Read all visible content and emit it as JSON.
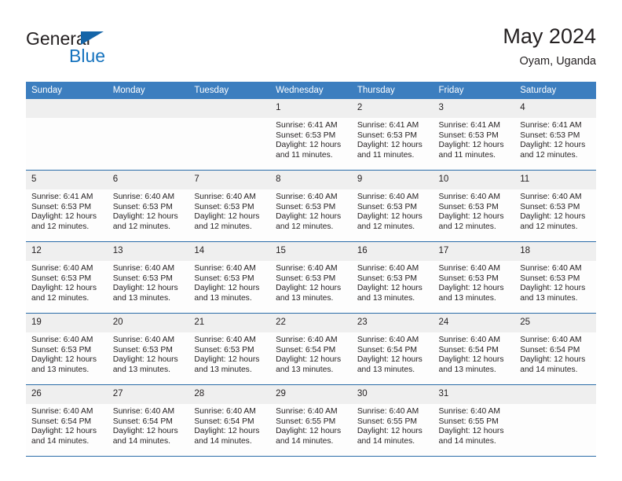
{
  "brand": {
    "name_dark": "General",
    "name_blue": "Blue",
    "logo_icon": "triangle-icon",
    "accent_color": "#1673be"
  },
  "header": {
    "title": "May 2024",
    "subtitle": "Oyam, Uganda"
  },
  "calendar": {
    "header_color": "#3c7ebf",
    "separator_color": "#2a6ca8",
    "daynum_band_color": "#efefef",
    "weekday_headers": [
      "Sunday",
      "Monday",
      "Tuesday",
      "Wednesday",
      "Thursday",
      "Friday",
      "Saturday"
    ],
    "weeks": [
      [
        {
          "day": "",
          "lines": []
        },
        {
          "day": "",
          "lines": []
        },
        {
          "day": "",
          "lines": []
        },
        {
          "day": "1",
          "lines": [
            "Sunrise: 6:41 AM",
            "Sunset: 6:53 PM",
            "Daylight: 12 hours",
            "and 11 minutes."
          ]
        },
        {
          "day": "2",
          "lines": [
            "Sunrise: 6:41 AM",
            "Sunset: 6:53 PM",
            "Daylight: 12 hours",
            "and 11 minutes."
          ]
        },
        {
          "day": "3",
          "lines": [
            "Sunrise: 6:41 AM",
            "Sunset: 6:53 PM",
            "Daylight: 12 hours",
            "and 11 minutes."
          ]
        },
        {
          "day": "4",
          "lines": [
            "Sunrise: 6:41 AM",
            "Sunset: 6:53 PM",
            "Daylight: 12 hours",
            "and 12 minutes."
          ]
        }
      ],
      [
        {
          "day": "5",
          "lines": [
            "Sunrise: 6:41 AM",
            "Sunset: 6:53 PM",
            "Daylight: 12 hours",
            "and 12 minutes."
          ]
        },
        {
          "day": "6",
          "lines": [
            "Sunrise: 6:40 AM",
            "Sunset: 6:53 PM",
            "Daylight: 12 hours",
            "and 12 minutes."
          ]
        },
        {
          "day": "7",
          "lines": [
            "Sunrise: 6:40 AM",
            "Sunset: 6:53 PM",
            "Daylight: 12 hours",
            "and 12 minutes."
          ]
        },
        {
          "day": "8",
          "lines": [
            "Sunrise: 6:40 AM",
            "Sunset: 6:53 PM",
            "Daylight: 12 hours",
            "and 12 minutes."
          ]
        },
        {
          "day": "9",
          "lines": [
            "Sunrise: 6:40 AM",
            "Sunset: 6:53 PM",
            "Daylight: 12 hours",
            "and 12 minutes."
          ]
        },
        {
          "day": "10",
          "lines": [
            "Sunrise: 6:40 AM",
            "Sunset: 6:53 PM",
            "Daylight: 12 hours",
            "and 12 minutes."
          ]
        },
        {
          "day": "11",
          "lines": [
            "Sunrise: 6:40 AM",
            "Sunset: 6:53 PM",
            "Daylight: 12 hours",
            "and 12 minutes."
          ]
        }
      ],
      [
        {
          "day": "12",
          "lines": [
            "Sunrise: 6:40 AM",
            "Sunset: 6:53 PM",
            "Daylight: 12 hours",
            "and 12 minutes."
          ]
        },
        {
          "day": "13",
          "lines": [
            "Sunrise: 6:40 AM",
            "Sunset: 6:53 PM",
            "Daylight: 12 hours",
            "and 13 minutes."
          ]
        },
        {
          "day": "14",
          "lines": [
            "Sunrise: 6:40 AM",
            "Sunset: 6:53 PM",
            "Daylight: 12 hours",
            "and 13 minutes."
          ]
        },
        {
          "day": "15",
          "lines": [
            "Sunrise: 6:40 AM",
            "Sunset: 6:53 PM",
            "Daylight: 12 hours",
            "and 13 minutes."
          ]
        },
        {
          "day": "16",
          "lines": [
            "Sunrise: 6:40 AM",
            "Sunset: 6:53 PM",
            "Daylight: 12 hours",
            "and 13 minutes."
          ]
        },
        {
          "day": "17",
          "lines": [
            "Sunrise: 6:40 AM",
            "Sunset: 6:53 PM",
            "Daylight: 12 hours",
            "and 13 minutes."
          ]
        },
        {
          "day": "18",
          "lines": [
            "Sunrise: 6:40 AM",
            "Sunset: 6:53 PM",
            "Daylight: 12 hours",
            "and 13 minutes."
          ]
        }
      ],
      [
        {
          "day": "19",
          "lines": [
            "Sunrise: 6:40 AM",
            "Sunset: 6:53 PM",
            "Daylight: 12 hours",
            "and 13 minutes."
          ]
        },
        {
          "day": "20",
          "lines": [
            "Sunrise: 6:40 AM",
            "Sunset: 6:53 PM",
            "Daylight: 12 hours",
            "and 13 minutes."
          ]
        },
        {
          "day": "21",
          "lines": [
            "Sunrise: 6:40 AM",
            "Sunset: 6:53 PM",
            "Daylight: 12 hours",
            "and 13 minutes."
          ]
        },
        {
          "day": "22",
          "lines": [
            "Sunrise: 6:40 AM",
            "Sunset: 6:54 PM",
            "Daylight: 12 hours",
            "and 13 minutes."
          ]
        },
        {
          "day": "23",
          "lines": [
            "Sunrise: 6:40 AM",
            "Sunset: 6:54 PM",
            "Daylight: 12 hours",
            "and 13 minutes."
          ]
        },
        {
          "day": "24",
          "lines": [
            "Sunrise: 6:40 AM",
            "Sunset: 6:54 PM",
            "Daylight: 12 hours",
            "and 13 minutes."
          ]
        },
        {
          "day": "25",
          "lines": [
            "Sunrise: 6:40 AM",
            "Sunset: 6:54 PM",
            "Daylight: 12 hours",
            "and 14 minutes."
          ]
        }
      ],
      [
        {
          "day": "26",
          "lines": [
            "Sunrise: 6:40 AM",
            "Sunset: 6:54 PM",
            "Daylight: 12 hours",
            "and 14 minutes."
          ]
        },
        {
          "day": "27",
          "lines": [
            "Sunrise: 6:40 AM",
            "Sunset: 6:54 PM",
            "Daylight: 12 hours",
            "and 14 minutes."
          ]
        },
        {
          "day": "28",
          "lines": [
            "Sunrise: 6:40 AM",
            "Sunset: 6:54 PM",
            "Daylight: 12 hours",
            "and 14 minutes."
          ]
        },
        {
          "day": "29",
          "lines": [
            "Sunrise: 6:40 AM",
            "Sunset: 6:55 PM",
            "Daylight: 12 hours",
            "and 14 minutes."
          ]
        },
        {
          "day": "30",
          "lines": [
            "Sunrise: 6:40 AM",
            "Sunset: 6:55 PM",
            "Daylight: 12 hours",
            "and 14 minutes."
          ]
        },
        {
          "day": "31",
          "lines": [
            "Sunrise: 6:40 AM",
            "Sunset: 6:55 PM",
            "Daylight: 12 hours",
            "and 14 minutes."
          ]
        },
        {
          "day": "",
          "lines": []
        }
      ]
    ]
  }
}
